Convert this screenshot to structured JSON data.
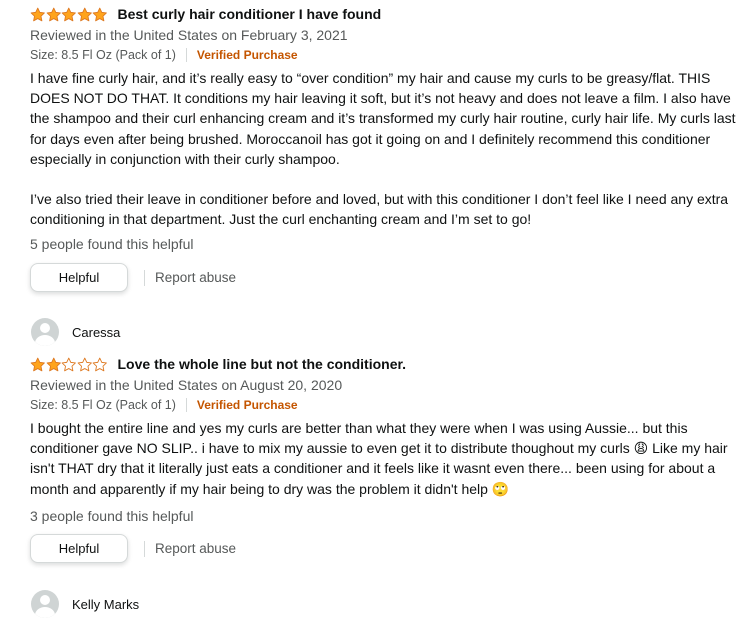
{
  "colors": {
    "star": "#ffa41c",
    "star_outline": "#de7921",
    "verified": "#c45500",
    "muted": "#565959"
  },
  "reviews": [
    {
      "rating": 5,
      "title": "Best curly hair conditioner I have found",
      "date_line": "Reviewed in the United States on February 3, 2021",
      "size": "Size: 8.5 Fl Oz (Pack of 1)",
      "verified": "Verified Purchase",
      "body": [
        "I have fine curly hair, and it’s really easy to “over condition” my hair and cause my curls to be greasy/flat. THIS DOES NOT DO THAT. It conditions my hair leaving it soft, but it’s not heavy and does not leave a film. I also have the shampoo and their curl enhancing cream and it’s transformed my curly hair routine, curly hair life. My curls last for days even after being brushed. Moroccanoil has got it going on and I definitely recommend this conditioner especially in conjunction with their curly shampoo.",
        "I’ve also tried their leave in conditioner before and loved, but with this conditioner I don’t feel like I need any extra conditioning in that department. Just the curl enchanting cream and I’m set to go!"
      ],
      "helpful_count": "5 people found this helpful",
      "helpful_button": "Helpful",
      "report": "Report abuse"
    },
    {
      "reviewer": "Caressa",
      "rating": 2,
      "title": "Love the whole line but not the conditioner.",
      "date_line": "Reviewed in the United States on August 20, 2020",
      "size": "Size: 8.5 Fl Oz (Pack of 1)",
      "verified": "Verified Purchase",
      "body": [
        "I bought the entire line and yes my curls are better than what they were when I was using Aussie... but this conditioner gave NO SLIP.. i have to mix my aussie to even get it to distribute thoughout my curls 😩 Like my hair isn't THAT dry that it literally just eats a conditioner and it feels like it wasnt even there... been using for about a month and apparently if my hair being to dry was the problem it didn't help 🙄"
      ],
      "helpful_count": "3 people found this helpful",
      "helpful_button": "Helpful",
      "report": "Report abuse"
    }
  ],
  "next_reviewer": "Kelly Marks"
}
